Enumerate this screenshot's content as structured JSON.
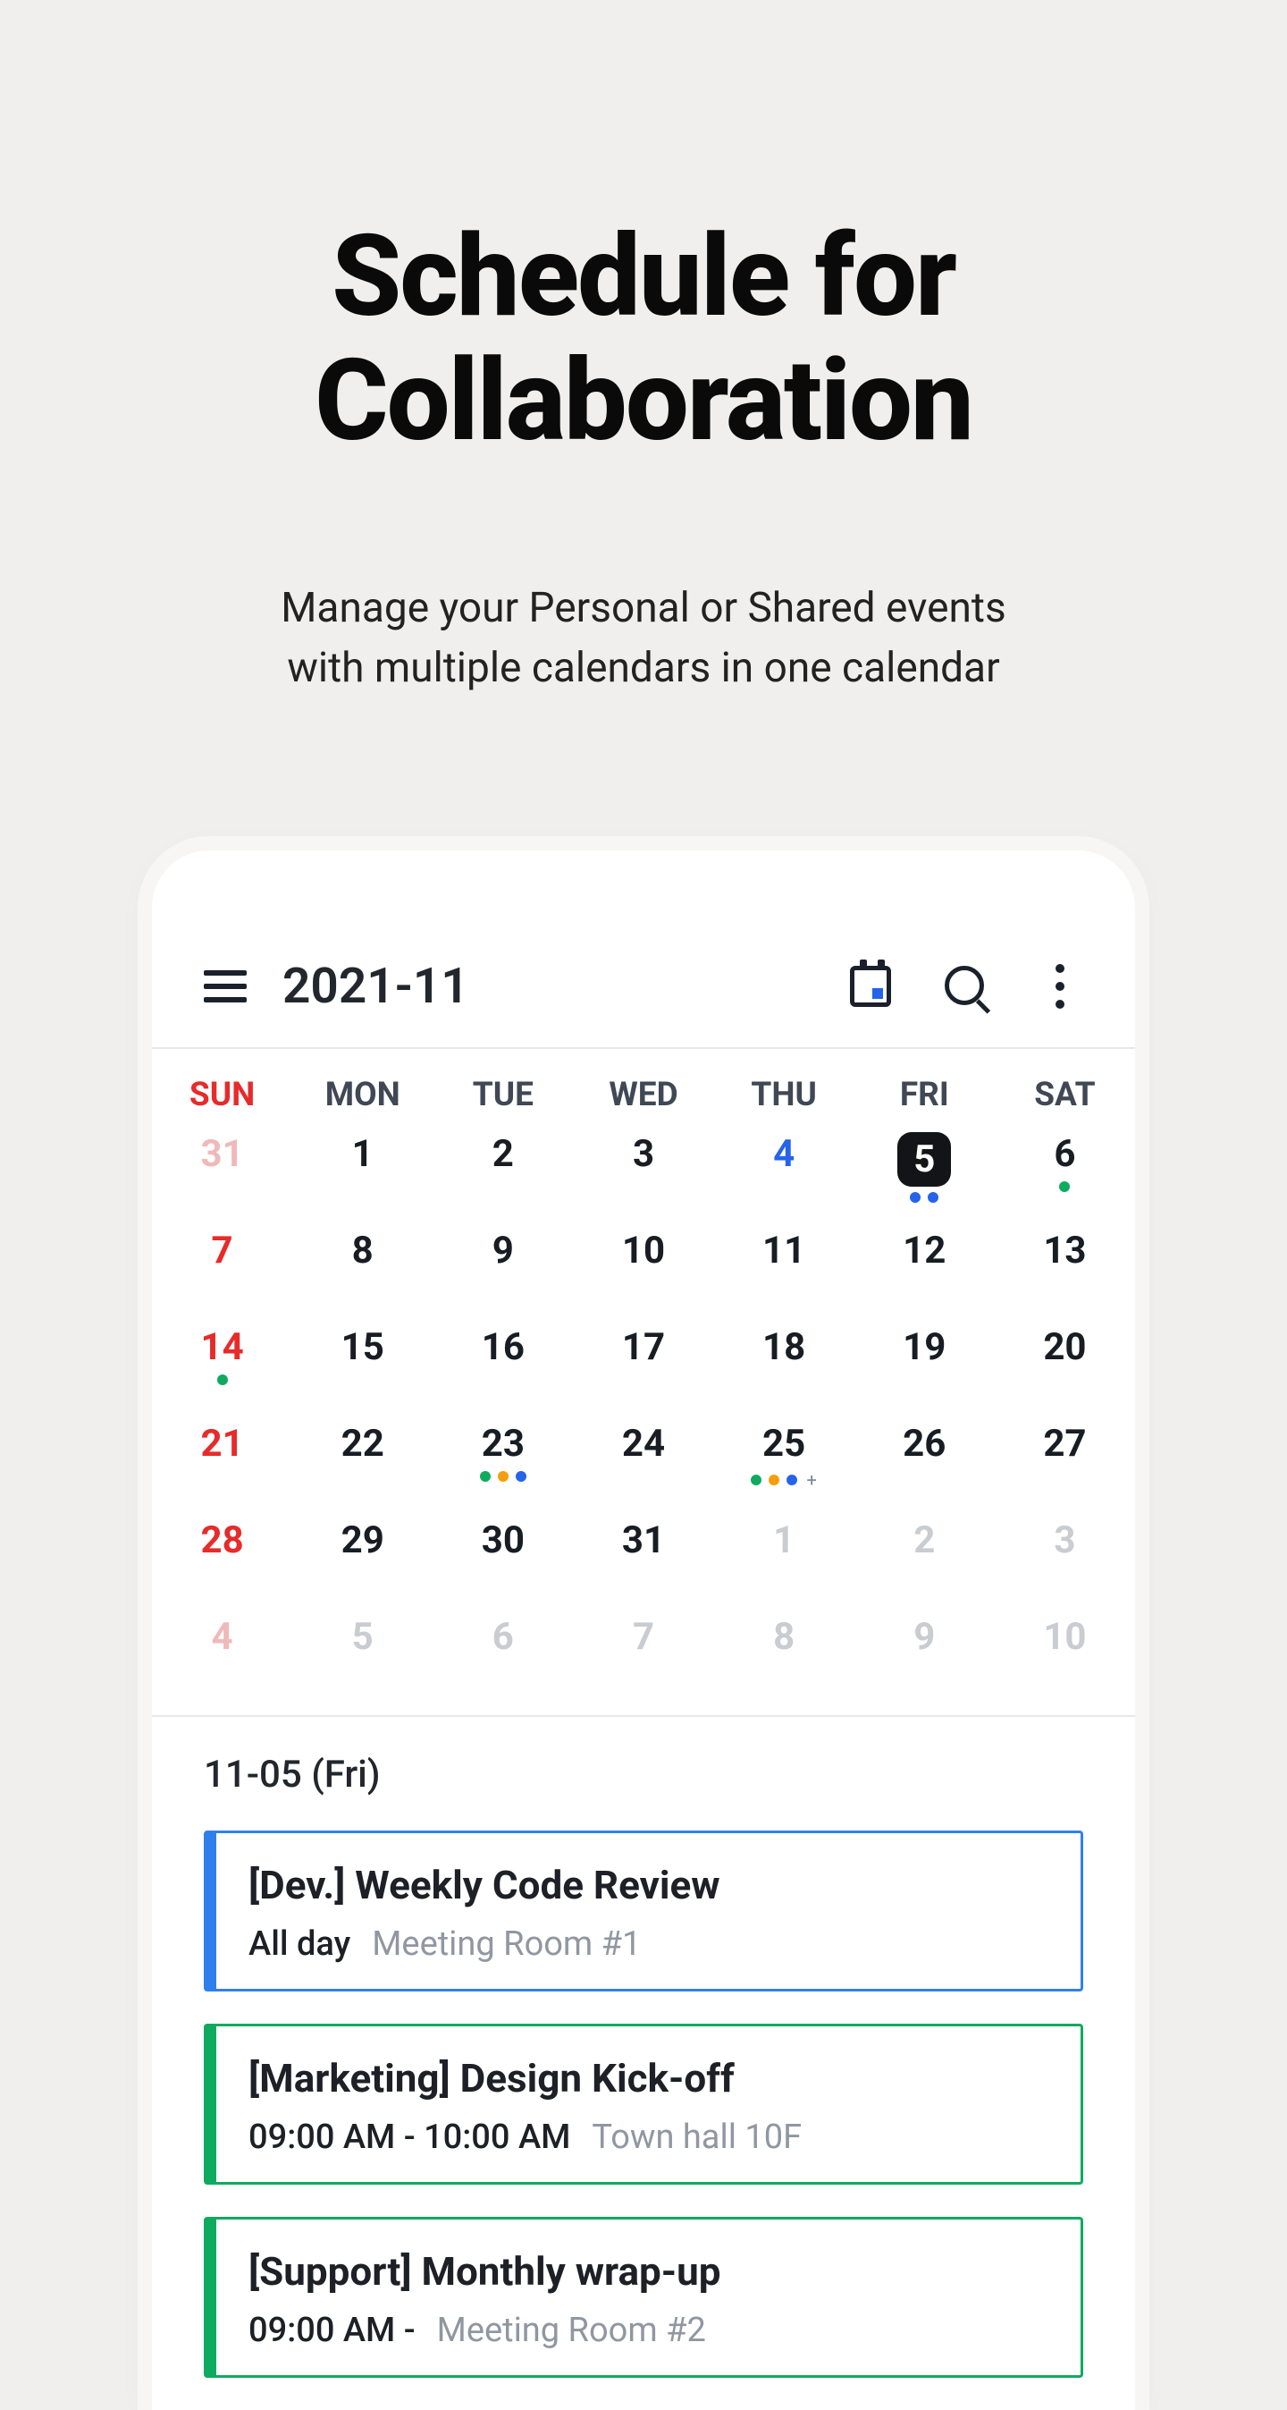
{
  "hero": {
    "title": "Schedule for Collaboration",
    "subtitle_l1": "Manage your Personal or Shared events",
    "subtitle_l2": "with multiple calendars in one calendar"
  },
  "topbar": {
    "month": "2021-11"
  },
  "dow": [
    "SUN",
    "MON",
    "TUE",
    "WED",
    "THU",
    "FRI",
    "SAT"
  ],
  "weeks": [
    [
      {
        "n": "31",
        "cls": "out-sun"
      },
      {
        "n": "1"
      },
      {
        "n": "2"
      },
      {
        "n": "3"
      },
      {
        "n": "4",
        "cls": "today"
      },
      {
        "n": "5",
        "selected": true,
        "dots": [
          "blue",
          "blue"
        ]
      },
      {
        "n": "6",
        "dots": [
          "green"
        ]
      }
    ],
    [
      {
        "n": "7",
        "cls": "sun"
      },
      {
        "n": "8"
      },
      {
        "n": "9"
      },
      {
        "n": "10"
      },
      {
        "n": "11"
      },
      {
        "n": "12"
      },
      {
        "n": "13"
      }
    ],
    [
      {
        "n": "14",
        "cls": "sun",
        "dots": [
          "green"
        ]
      },
      {
        "n": "15"
      },
      {
        "n": "16"
      },
      {
        "n": "17"
      },
      {
        "n": "18"
      },
      {
        "n": "19"
      },
      {
        "n": "20"
      }
    ],
    [
      {
        "n": "21",
        "cls": "sun"
      },
      {
        "n": "22"
      },
      {
        "n": "23",
        "dots": [
          "green",
          "orange",
          "blue"
        ]
      },
      {
        "n": "24"
      },
      {
        "n": "25",
        "dots": [
          "green",
          "orange",
          "blue"
        ],
        "more": true
      },
      {
        "n": "26"
      },
      {
        "n": "27"
      }
    ],
    [
      {
        "n": "28",
        "cls": "sun"
      },
      {
        "n": "29"
      },
      {
        "n": "30"
      },
      {
        "n": "31"
      },
      {
        "n": "1",
        "cls": "out"
      },
      {
        "n": "2",
        "cls": "out"
      },
      {
        "n": "3",
        "cls": "out"
      }
    ],
    [
      {
        "n": "4",
        "cls": "out-sun"
      },
      {
        "n": "5",
        "cls": "out"
      },
      {
        "n": "6",
        "cls": "out"
      },
      {
        "n": "7",
        "cls": "out"
      },
      {
        "n": "8",
        "cls": "out"
      },
      {
        "n": "9",
        "cls": "out"
      },
      {
        "n": "10",
        "cls": "out"
      }
    ]
  ],
  "agenda": {
    "date_label": "11-05 (Fri)",
    "events": [
      {
        "title": "[Dev.] Weekly Code Review",
        "time": "All day",
        "loc": "Meeting Room #1",
        "color": "blue"
      },
      {
        "title": "[Marketing] Design Kick-off",
        "time": "09:00 AM - 10:00 AM",
        "loc": "Town hall 10F",
        "color": "green"
      },
      {
        "title": "[Support] Monthly wrap-up",
        "time": "09:00 AM -",
        "loc": "Meeting Room #2",
        "color": "green"
      }
    ]
  }
}
